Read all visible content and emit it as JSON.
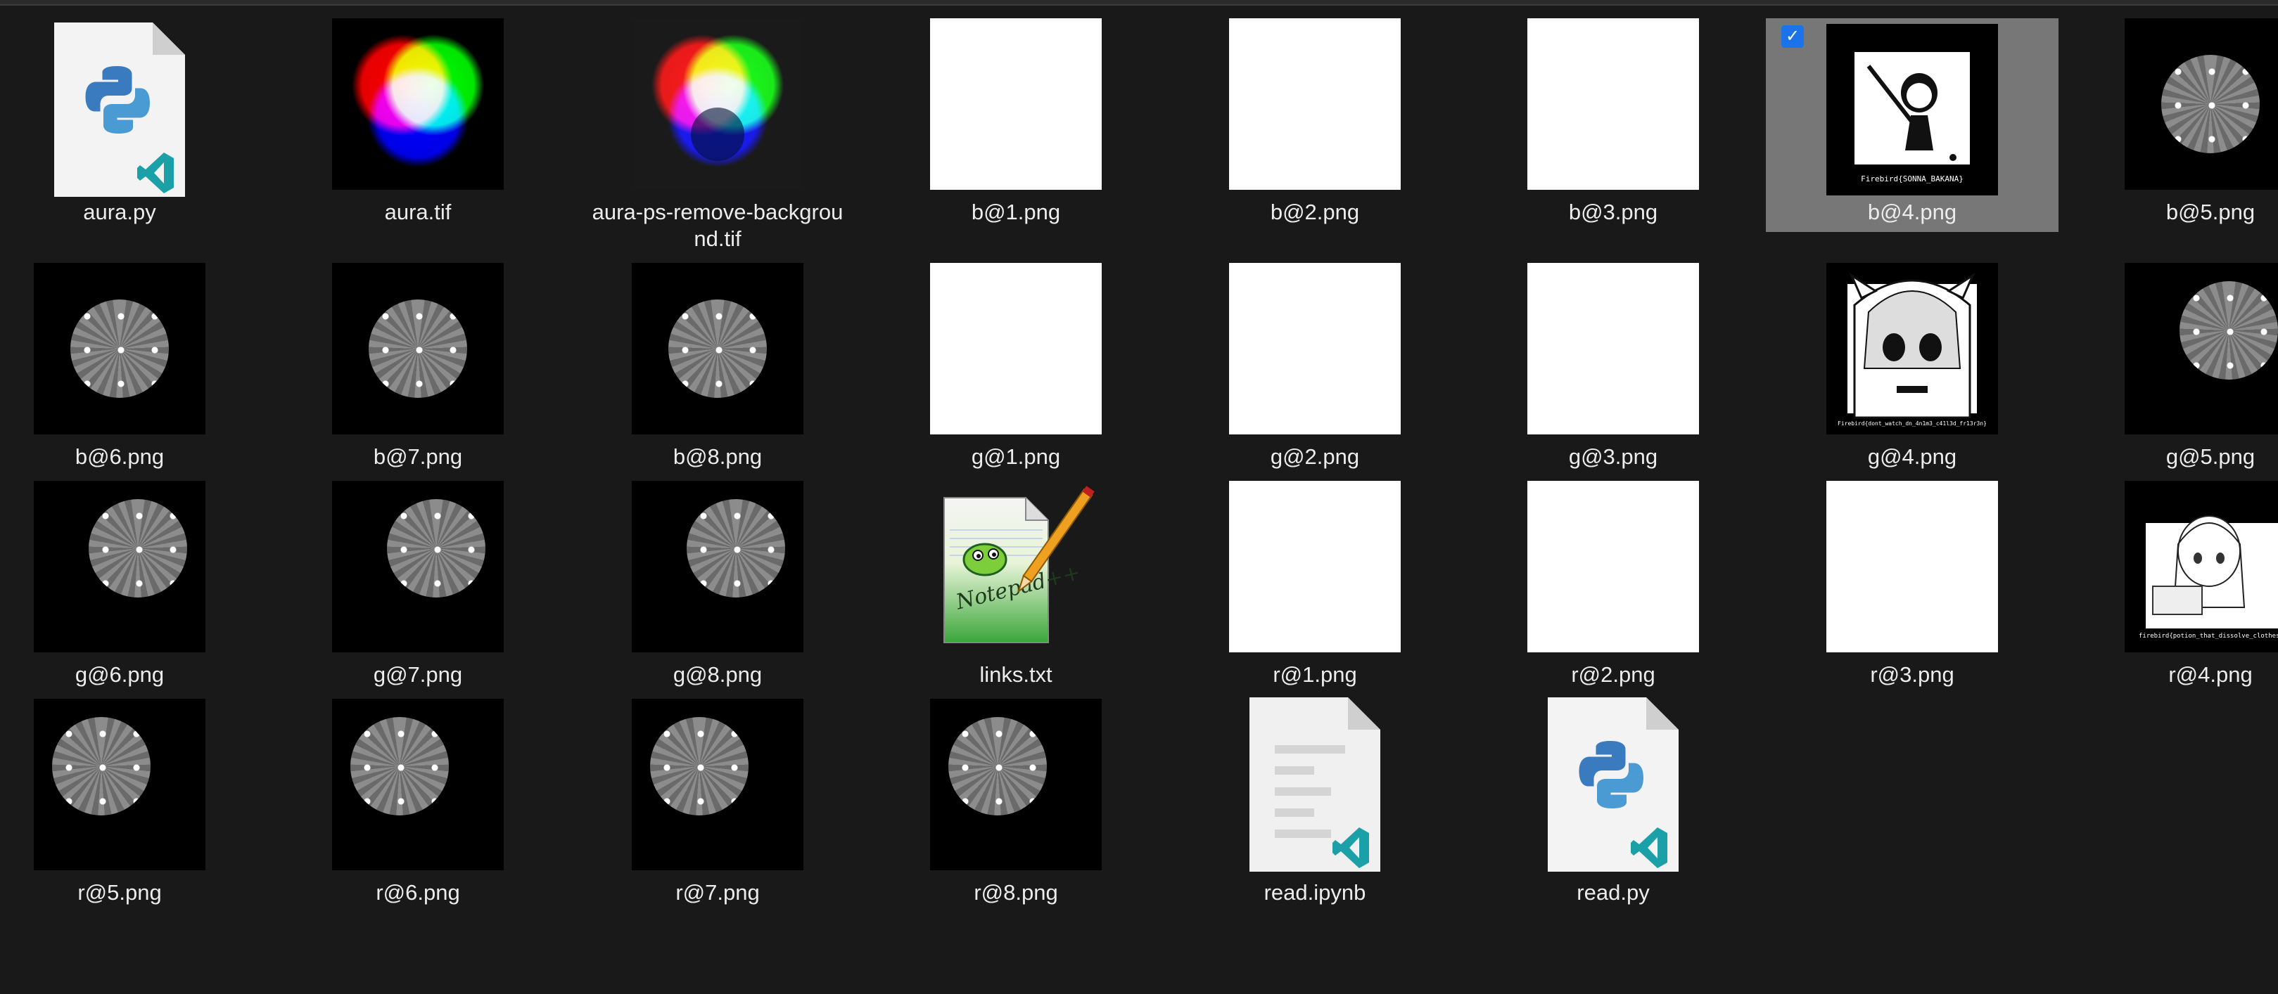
{
  "files": [
    {
      "name": "aura.py",
      "type": "python-file"
    },
    {
      "name": "aura.tif",
      "type": "rgb-aura-image"
    },
    {
      "name": "aura-ps-remove-backgrou\nnd.tif",
      "type": "rgb-aura-image"
    },
    {
      "name": "b@1.png",
      "type": "white-image"
    },
    {
      "name": "b@2.png",
      "type": "white-image"
    },
    {
      "name": "b@3.png",
      "type": "white-image"
    },
    {
      "name": "b@4.png",
      "type": "anime-image",
      "selected": true,
      "caption": "Firebird{SONNA_BAKANA}"
    },
    {
      "name": "b@5.png",
      "type": "pattern-disc-image"
    },
    {
      "name": "b@6.png",
      "type": "pattern-disc-image"
    },
    {
      "name": "b@7.png",
      "type": "pattern-disc-image"
    },
    {
      "name": "b@8.png",
      "type": "pattern-disc-image"
    },
    {
      "name": "g@1.png",
      "type": "white-image"
    },
    {
      "name": "g@2.png",
      "type": "white-image"
    },
    {
      "name": "g@3.png",
      "type": "white-image"
    },
    {
      "name": "g@4.png",
      "type": "anime-image",
      "caption": "Firebird{dont_watch_dn_4n1m3_c41l3d_fr13r3n}"
    },
    {
      "name": "g@5.png",
      "type": "pattern-disc-image"
    },
    {
      "name": "g@6.png",
      "type": "pattern-disc-image"
    },
    {
      "name": "g@7.png",
      "type": "pattern-disc-image"
    },
    {
      "name": "g@8.png",
      "type": "pattern-disc-image"
    },
    {
      "name": "links.txt",
      "type": "notepad-file"
    },
    {
      "name": "r@1.png",
      "type": "white-image"
    },
    {
      "name": "r@2.png",
      "type": "white-image"
    },
    {
      "name": "r@3.png",
      "type": "white-image"
    },
    {
      "name": "r@4.png",
      "type": "anime-image",
      "caption": "firebird{potion_that_dissolve_clothes"
    },
    {
      "name": "r@5.png",
      "type": "pattern-disc-image"
    },
    {
      "name": "r@6.png",
      "type": "pattern-disc-image"
    },
    {
      "name": "r@7.png",
      "type": "pattern-disc-image"
    },
    {
      "name": "r@8.png",
      "type": "pattern-disc-image"
    },
    {
      "name": "read.ipynb",
      "type": "notebook-file"
    },
    {
      "name": "read.py",
      "type": "python-file"
    }
  ],
  "selection_check": "✓",
  "notepad_text": "Notepad++",
  "colors": {
    "background": "#191919",
    "selected": "#777777",
    "checkbox": "#1a73e8"
  }
}
